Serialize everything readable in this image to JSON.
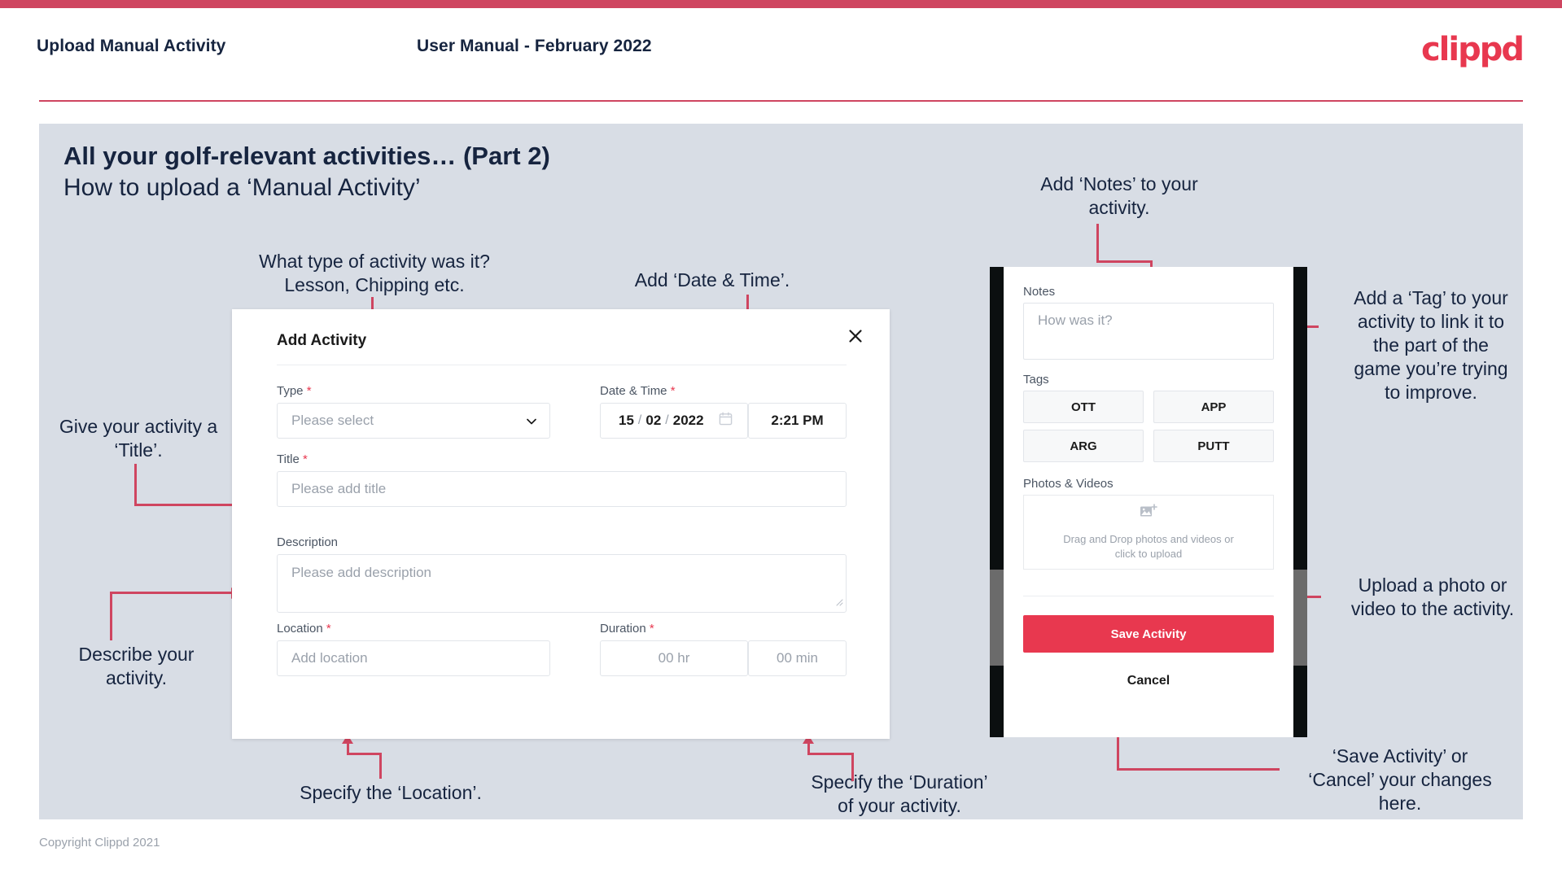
{
  "header": {
    "title": "Upload Manual Activity",
    "subtitle": "User Manual - February 2022",
    "logo": "clippd"
  },
  "slide": {
    "title": "All your golf-relevant activities… (Part 2)",
    "subtitle": "How to upload a ‘Manual Activity’"
  },
  "footer": {
    "copyright": "Copyright Clippd 2021"
  },
  "annotations": {
    "type": "What type of activity was it?\nLesson, Chipping etc.",
    "date_time": "Add ‘Date & Time’.",
    "title": "Give your activity a\n‘Title’.",
    "description": "Describe your\nactivity.",
    "location": "Specify the ‘Location’.",
    "duration": "Specify the ‘Duration’\nof your activity.",
    "notes": "Add ‘Notes’ to your\nactivity.",
    "tags": "Add a ‘Tag’ to your\nactivity to link it to\nthe part of the\ngame you’re trying\nto improve.",
    "photos": "Upload a photo or\nvideo to the activity.",
    "save_cancel": "‘Save Activity’ or\n‘Cancel’ your changes\nhere."
  },
  "dialog": {
    "title": "Add Activity",
    "close_icon": "close-icon",
    "fields": {
      "type": {
        "label": "Type",
        "required": "*",
        "placeholder": "Please select",
        "chevron": "chevron-down-icon"
      },
      "date_time": {
        "label": "Date & Time",
        "required": "*",
        "day": "15",
        "sep1": "/",
        "month": "02",
        "sep2": "/",
        "year": "2022",
        "calendar_icon": "calendar-icon",
        "time": "2:21 PM"
      },
      "title": {
        "label": "Title",
        "required": "*",
        "placeholder": "Please add title"
      },
      "description": {
        "label": "Description",
        "required": "",
        "placeholder": "Please add description"
      },
      "location": {
        "label": "Location",
        "required": "*",
        "placeholder": "Add location"
      },
      "duration": {
        "label": "Duration",
        "required": "*",
        "hours_placeholder": "00 hr",
        "minutes_placeholder": "00 min"
      }
    }
  },
  "phone": {
    "notes": {
      "label": "Notes",
      "placeholder": "How was it?"
    },
    "tags": {
      "label": "Tags",
      "items": [
        "OTT",
        "APP",
        "ARG",
        "PUTT"
      ]
    },
    "photos": {
      "label": "Photos & Videos",
      "icon": "add-image-icon",
      "line1": "Drag and Drop photos and videos or",
      "line2": "click to upload"
    },
    "save_label": "Save Activity",
    "cancel_label": "Cancel"
  },
  "colors": {
    "brand_pink": "#e8384f",
    "rule_pink": "#cf4560",
    "slide_bg": "#d8dde5",
    "text_dark": "#16243f"
  }
}
